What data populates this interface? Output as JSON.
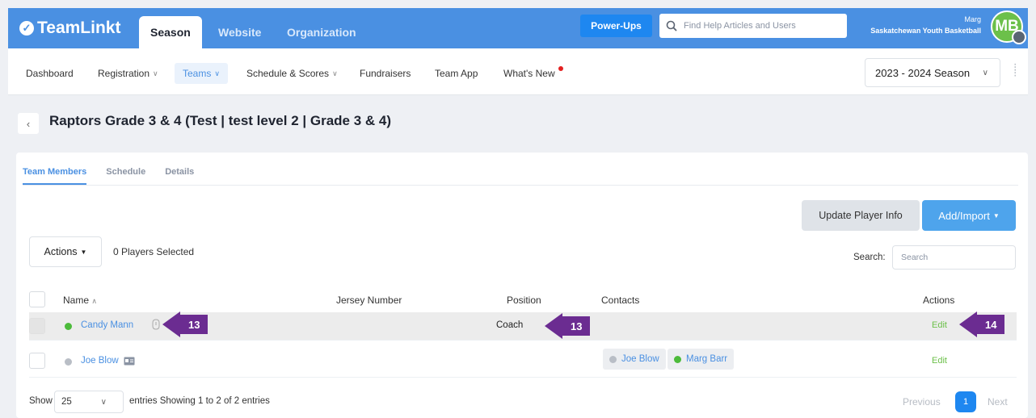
{
  "topbar": {
    "logo": "TeamLinkt",
    "tabs": [
      {
        "label": "Season",
        "active": true
      },
      {
        "label": "Website",
        "active": false
      },
      {
        "label": "Organization",
        "active": false
      }
    ],
    "powerups_label": "Power-Ups",
    "help_search_placeholder": "Find Help Articles and Users",
    "user_name": "Marg",
    "org_name": "Saskatchewan Youth Basketball",
    "avatar_initials": "MB",
    "accent_color": "#4a90e2"
  },
  "subnav": {
    "items": [
      {
        "label": "Dashboard"
      },
      {
        "label": "Registration"
      },
      {
        "label": "Teams"
      },
      {
        "label": "Schedule & Scores"
      },
      {
        "label": "Fundraisers"
      },
      {
        "label": "Team App"
      },
      {
        "label": "What's New"
      }
    ],
    "season": "2023 - 2024 Season"
  },
  "page": {
    "title": "Raptors Grade 3 & 4 (Test | test level 2 | Grade 3 & 4)"
  },
  "tabs": [
    {
      "label": "Team Members",
      "active": true
    },
    {
      "label": "Schedule",
      "active": false
    },
    {
      "label": "Details",
      "active": false
    }
  ],
  "toolbar": {
    "update_label": "Update Player Info",
    "add_label": "Add/Import",
    "actions_label": "Actions",
    "selected_text": "0 Players Selected",
    "search_label": "Search:",
    "search_placeholder": "Search"
  },
  "table": {
    "headers": {
      "name": "Name",
      "jersey": "Jersey Number",
      "position": "Position",
      "contacts": "Contacts",
      "actions": "Actions"
    },
    "rows": [
      {
        "name": "Candy Mann",
        "status": "green",
        "position": "Coach",
        "contacts": [],
        "action": "Edit"
      },
      {
        "name": "Joe Blow",
        "status": "grey",
        "position": "",
        "contacts": [
          {
            "name": "Joe Blow",
            "status": "grey"
          },
          {
            "name": "Marg Barr",
            "status": "green"
          }
        ],
        "action": "Edit"
      }
    ]
  },
  "footer": {
    "show_label": "Show",
    "page_length": "25",
    "entries_text": "entries  Showing 1 to 2 of 2 entries",
    "prev_label": "Previous",
    "current_page": "1",
    "next_label": "Next"
  },
  "callouts": [
    "13",
    "13",
    "14"
  ]
}
